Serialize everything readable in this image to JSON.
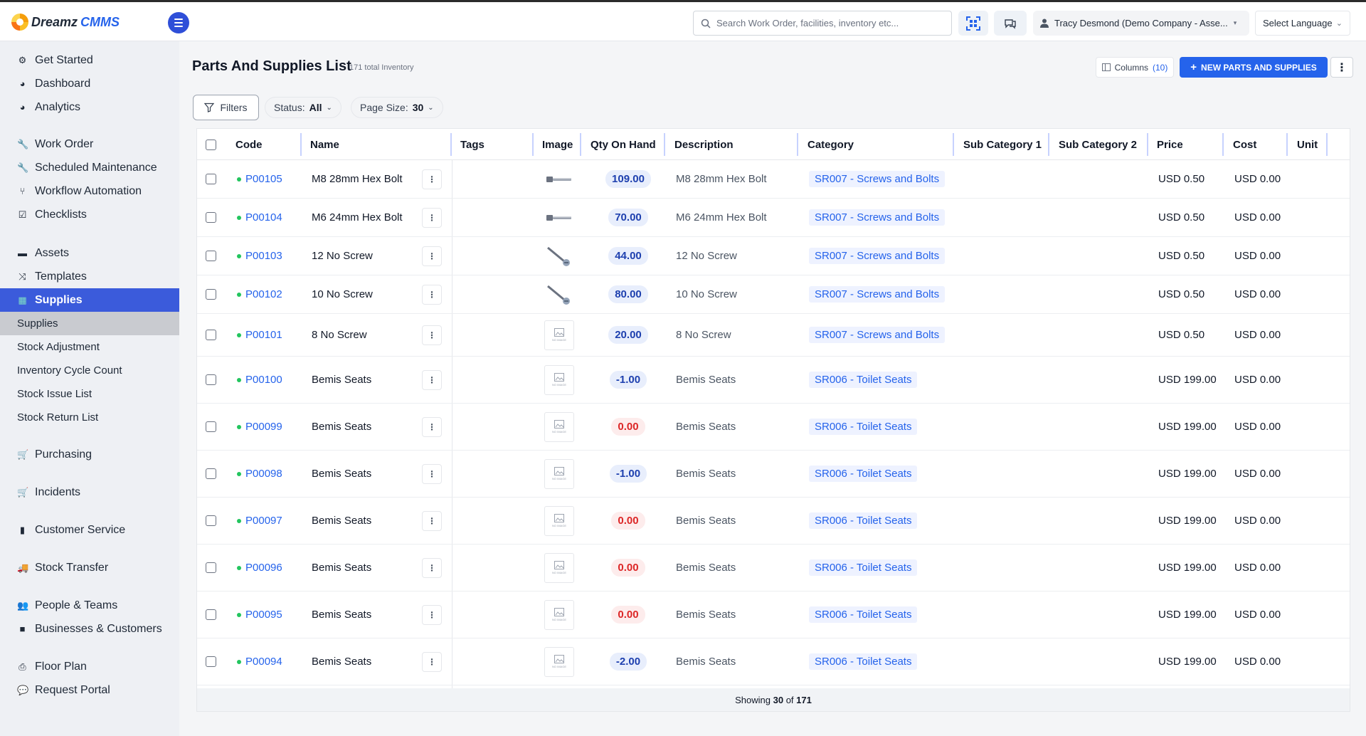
{
  "app": {
    "brand_part1": "Dreamz",
    "brand_part2": "CMMS"
  },
  "search": {
    "placeholder": "Search Work Order, facilities, inventory etc..."
  },
  "user": {
    "label": "Tracy Desmond (Demo Company - Asse..."
  },
  "language": {
    "label": "Select Language"
  },
  "sidebar": {
    "items": [
      {
        "label": "Get Started",
        "icon": "gears-icon"
      },
      {
        "label": "Dashboard",
        "icon": "dashboard-icon"
      },
      {
        "label": "Analytics",
        "icon": "analytics-icon"
      },
      {
        "label": "Work Order",
        "icon": "wrench-icon"
      },
      {
        "label": "Scheduled Maintenance",
        "icon": "wrench-icon"
      },
      {
        "label": "Workflow Automation",
        "icon": "workflow-icon"
      },
      {
        "label": "Checklists",
        "icon": "checkbox-icon"
      },
      {
        "label": "Assets",
        "icon": "assets-icon"
      },
      {
        "label": "Templates",
        "icon": "shuffle-icon"
      },
      {
        "label": "Supplies",
        "icon": "supplies-icon"
      },
      {
        "label": "Purchasing",
        "icon": "cart-icon"
      },
      {
        "label": "Incidents",
        "icon": "cart-icon"
      },
      {
        "label": "Customer Service",
        "icon": "file-icon"
      },
      {
        "label": "Stock Transfer",
        "icon": "truck-icon"
      },
      {
        "label": "People & Teams",
        "icon": "people-icon"
      },
      {
        "label": "Businesses & Customers",
        "icon": "video-icon"
      },
      {
        "label": "Floor Plan",
        "icon": "print-icon"
      },
      {
        "label": "Request Portal",
        "icon": "chat-icon"
      }
    ],
    "sub_items": [
      "Supplies",
      "Stock Adjustment",
      "Inventory Cycle Count",
      "Stock Issue List",
      "Stock Return List"
    ]
  },
  "page": {
    "title": "Parts And Supplies List",
    "subtitle": "171 total Inventory",
    "columns_label": "Columns",
    "columns_count": "(10)",
    "new_button": "NEW PARTS AND SUPPLIES",
    "filters_label": "Filters",
    "status_label": "Status:",
    "status_value": "All",
    "page_size_label": "Page Size:",
    "page_size_value": "30"
  },
  "table": {
    "headers": [
      "Code",
      "Name",
      "Tags",
      "Image",
      "Qty On Hand",
      "Description",
      "Category",
      "Sub Category 1",
      "Sub Category 2",
      "Price",
      "Cost",
      "Unit"
    ],
    "rows": [
      {
        "code": "P00105",
        "name": "M8 28mm Hex Bolt",
        "image": "bolt",
        "qty": "109.00",
        "qty_kind": "pos",
        "description": "M8 28mm Hex Bolt",
        "category": "SR007 - Screws and Bolts",
        "price": "USD 0.50",
        "cost": "USD 0.00"
      },
      {
        "code": "P00104",
        "name": "M6 24mm Hex Bolt",
        "image": "bolt",
        "qty": "70.00",
        "qty_kind": "pos",
        "description": "M6 24mm Hex Bolt",
        "category": "SR007 - Screws and Bolts",
        "price": "USD 0.50",
        "cost": "USD 0.00"
      },
      {
        "code": "P00103",
        "name": "12 No Screw",
        "image": "screw",
        "qty": "44.00",
        "qty_kind": "pos",
        "description": "12 No Screw",
        "category": "SR007 - Screws and Bolts",
        "price": "USD 0.50",
        "cost": "USD 0.00"
      },
      {
        "code": "P00102",
        "name": "10 No Screw",
        "image": "screw",
        "qty": "80.00",
        "qty_kind": "pos",
        "description": "10 No Screw",
        "category": "SR007 - Screws and Bolts",
        "price": "USD 0.50",
        "cost": "USD 0.00"
      },
      {
        "code": "P00101",
        "name": "8 No Screw",
        "image": "none",
        "qty": "20.00",
        "qty_kind": "pos",
        "description": "8 No Screw",
        "category": "SR007 - Screws and Bolts",
        "price": "USD 0.50",
        "cost": "USD 0.00"
      },
      {
        "code": "P00100",
        "name": "Bemis Seats",
        "image": "none",
        "qty": "-1.00",
        "qty_kind": "neg",
        "description": "Bemis Seats",
        "category": "SR006 - Toilet Seats",
        "price": "USD 199.00",
        "cost": "USD 0.00"
      },
      {
        "code": "P00099",
        "name": "Bemis Seats",
        "image": "none",
        "qty": "0.00",
        "qty_kind": "zero",
        "description": "Bemis Seats",
        "category": "SR006 - Toilet Seats",
        "price": "USD 199.00",
        "cost": "USD 0.00"
      },
      {
        "code": "P00098",
        "name": "Bemis Seats",
        "image": "none",
        "qty": "-1.00",
        "qty_kind": "neg",
        "description": "Bemis Seats",
        "category": "SR006 - Toilet Seats",
        "price": "USD 199.00",
        "cost": "USD 0.00"
      },
      {
        "code": "P00097",
        "name": "Bemis Seats",
        "image": "none",
        "qty": "0.00",
        "qty_kind": "zero",
        "description": "Bemis Seats",
        "category": "SR006 - Toilet Seats",
        "price": "USD 199.00",
        "cost": "USD 0.00"
      },
      {
        "code": "P00096",
        "name": "Bemis Seats",
        "image": "none",
        "qty": "0.00",
        "qty_kind": "zero",
        "description": "Bemis Seats",
        "category": "SR006 - Toilet Seats",
        "price": "USD 199.00",
        "cost": "USD 0.00"
      },
      {
        "code": "P00095",
        "name": "Bemis Seats",
        "image": "none",
        "qty": "0.00",
        "qty_kind": "zero",
        "description": "Bemis Seats",
        "category": "SR006 - Toilet Seats",
        "price": "USD 199.00",
        "cost": "USD 0.00"
      },
      {
        "code": "P00094",
        "name": "Bemis Seats",
        "image": "none",
        "qty": "-2.00",
        "qty_kind": "neg",
        "description": "Bemis Seats",
        "category": "SR006 - Toilet Seats",
        "price": "USD 199.00",
        "cost": "USD 0.00"
      }
    ],
    "no_image_text": "NO IMAGE",
    "footer_prefix": "Showing",
    "footer_shown": "30",
    "footer_of": "of",
    "footer_total": "171"
  },
  "colors": {
    "accent": "#2563eb",
    "sidebar_active": "#3b5bdb",
    "status_dot": "#22c55e",
    "zero_qty": "#dc2626"
  }
}
